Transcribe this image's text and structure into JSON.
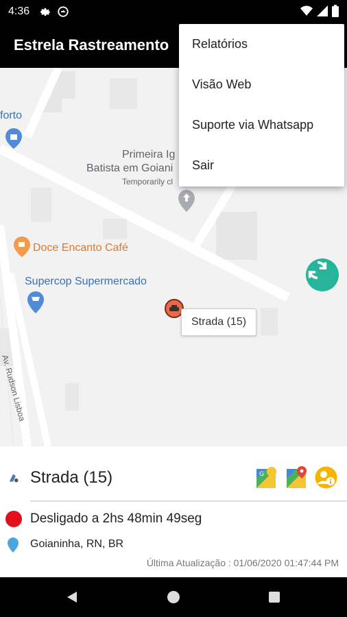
{
  "status_bar": {
    "time": "4:36",
    "icons": [
      "gear-icon",
      "sync-icon",
      "wifi-icon",
      "signal-icon",
      "battery-icon"
    ]
  },
  "app_bar": {
    "title": "Estrela Rastreamento"
  },
  "menu": {
    "items": [
      "Relatórios",
      "Visão Web",
      "Suporte via Whatsapp",
      "Sair"
    ]
  },
  "map": {
    "labels": {
      "conforto": "forto",
      "church_line1": "Primeira Ig",
      "church_line2": "Batista em Goiani",
      "church_note": "Temporarily cl",
      "cafe": "Doce Encanto Café",
      "supermarket": "Supercop Supermercado",
      "street": "Av. Rudson Lisboa"
    },
    "marker_tooltip": "Strada (15)"
  },
  "panel": {
    "vehicle_name": "Strada (15)",
    "status": "Desligado a 2hs 48min 49seg",
    "location": "Goianinha, RN, BR",
    "last_update": "Última Atualização : 01/06/2020 01:47:44 PM",
    "status_color": "#e3101b"
  },
  "colors": {
    "accent": "#26b59a",
    "marker": "#e8694b"
  }
}
